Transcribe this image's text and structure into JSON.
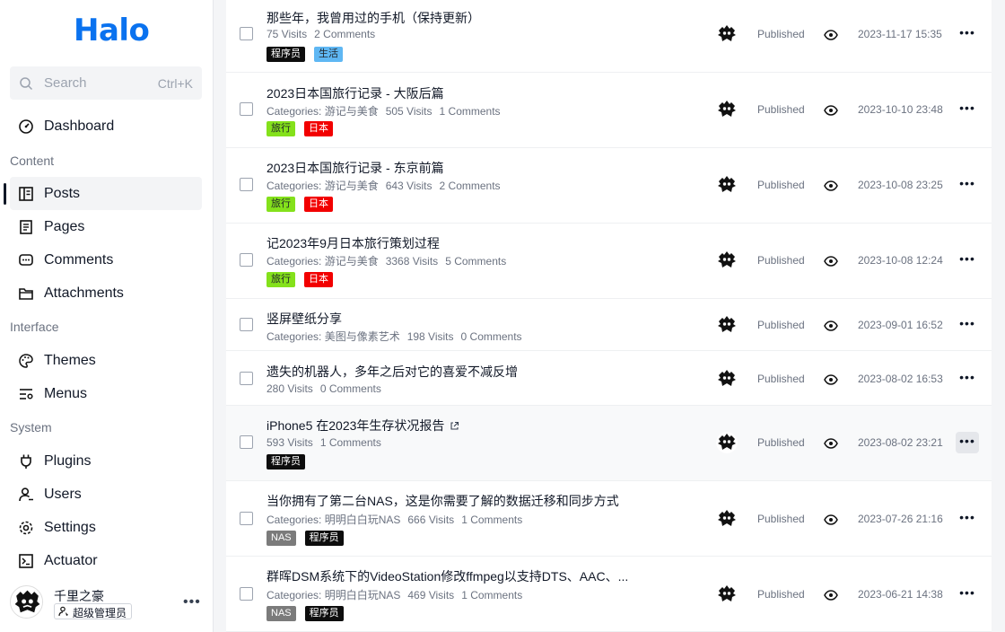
{
  "app": {
    "logo": "Halo"
  },
  "search": {
    "placeholder": "Search",
    "shortcut": "Ctrl+K"
  },
  "sidebar": {
    "dashboard": "Dashboard",
    "groups": {
      "content": "Content",
      "interface": "Interface",
      "system": "System"
    },
    "items": {
      "posts": "Posts",
      "pages": "Pages",
      "comments": "Comments",
      "attachments": "Attachments",
      "themes": "Themes",
      "menus": "Menus",
      "plugins": "Plugins",
      "users": "Users",
      "settings": "Settings",
      "actuator": "Actuator"
    },
    "user": {
      "name": "千里之豪",
      "role": "超级管理员"
    }
  },
  "colors": {
    "brand": "#0a72ef",
    "tag_black": "#0d0d0d",
    "tag_blue": "#5fb7f3",
    "tag_green": "#84e11b",
    "tag_red": "#f20000",
    "tag_gray": "#7b7b7b"
  },
  "posts": [
    {
      "title": "那些年，我曾用过的手机（保持更新）",
      "categories": "",
      "visits": "75 Visits",
      "comments": "2 Comments",
      "tags": [
        {
          "label": "程序员",
          "color": "#0d0d0d"
        },
        {
          "label": "生活",
          "color": "#5fb7f3",
          "text": "#1f2328"
        }
      ],
      "status": "Published",
      "date": "2023-11-17 15:35"
    },
    {
      "title": "2023日本国旅行记录 - 大阪后篇",
      "categories": "Categories: 游记与美食",
      "visits": "505 Visits",
      "comments": "1 Comments",
      "tags": [
        {
          "label": "旅行",
          "color": "#84e11b",
          "text": "#1f2328"
        },
        {
          "label": "日本",
          "color": "#f20000"
        }
      ],
      "status": "Published",
      "date": "2023-10-10 23:48"
    },
    {
      "title": "2023日本国旅行记录 - 东京前篇",
      "categories": "Categories: 游记与美食",
      "visits": "643 Visits",
      "comments": "2 Comments",
      "tags": [
        {
          "label": "旅行",
          "color": "#84e11b",
          "text": "#1f2328"
        },
        {
          "label": "日本",
          "color": "#f20000"
        }
      ],
      "status": "Published",
      "date": "2023-10-08 23:25"
    },
    {
      "title": "记2023年9月日本旅行策划过程",
      "categories": "Categories: 游记与美食",
      "visits": "3368 Visits",
      "comments": "5 Comments",
      "tags": [
        {
          "label": "旅行",
          "color": "#84e11b",
          "text": "#1f2328"
        },
        {
          "label": "日本",
          "color": "#f20000"
        }
      ],
      "status": "Published",
      "date": "2023-10-08 12:24"
    },
    {
      "title": "竖屏壁纸分享",
      "categories": "Categories: 美图与像素艺术",
      "visits": "198 Visits",
      "comments": "0 Comments",
      "tags": [],
      "status": "Published",
      "date": "2023-09-01 16:52"
    },
    {
      "title": "遗失的机器人，多年之后对它的喜爱不减反增",
      "categories": "",
      "visits": "280 Visits",
      "comments": "0 Comments",
      "tags": [],
      "status": "Published",
      "date": "2023-08-02 16:53"
    },
    {
      "title": "iPhone5 在2023年生存状况报告",
      "categories": "",
      "visits": "593 Visits",
      "comments": "1 Comments",
      "tags": [
        {
          "label": "程序员",
          "color": "#0d0d0d"
        }
      ],
      "status": "Published",
      "date": "2023-08-02 23:21",
      "external": true
    },
    {
      "title": "当你拥有了第二台NAS，这是你需要了解的数据迁移和同步方式",
      "categories": "Categories: 明明白白玩NAS",
      "visits": "666 Visits",
      "comments": "1 Comments",
      "tags": [
        {
          "label": "NAS",
          "color": "#7b7b7b"
        },
        {
          "label": "程序员",
          "color": "#0d0d0d"
        }
      ],
      "status": "Published",
      "date": "2023-07-26 21:16"
    },
    {
      "title": "群晖DSM系统下的VideoStation修改ffmpeg以支持DTS、AAC、...",
      "categories": "Categories: 明明白白玩NAS",
      "visits": "469 Visits",
      "comments": "1 Comments",
      "tags": [
        {
          "label": "NAS",
          "color": "#7b7b7b"
        },
        {
          "label": "程序员",
          "color": "#0d0d0d"
        }
      ],
      "status": "Published",
      "date": "2023-06-21 14:38"
    }
  ]
}
